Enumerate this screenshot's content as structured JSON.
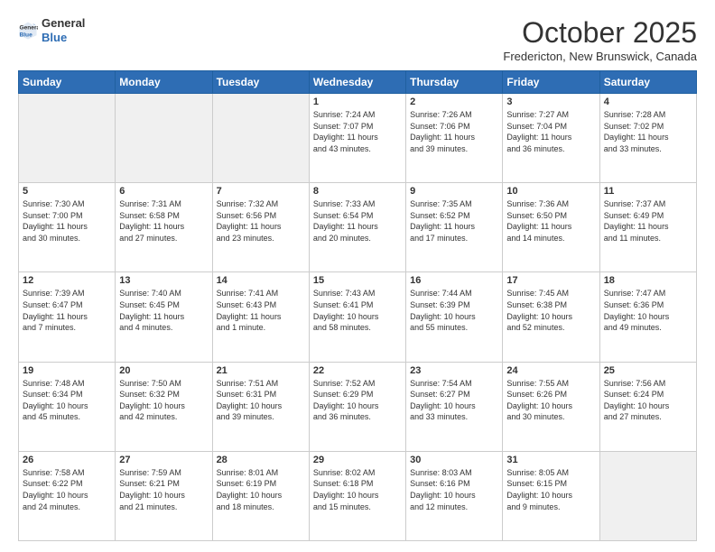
{
  "header": {
    "logo_general": "General",
    "logo_blue": "Blue",
    "month": "October 2025",
    "location": "Fredericton, New Brunswick, Canada"
  },
  "days_of_week": [
    "Sunday",
    "Monday",
    "Tuesday",
    "Wednesday",
    "Thursday",
    "Friday",
    "Saturday"
  ],
  "weeks": [
    [
      {
        "day": "",
        "info": "",
        "gray": true
      },
      {
        "day": "",
        "info": "",
        "gray": true
      },
      {
        "day": "",
        "info": "",
        "gray": true
      },
      {
        "day": "1",
        "info": "Sunrise: 7:24 AM\nSunset: 7:07 PM\nDaylight: 11 hours\nand 43 minutes."
      },
      {
        "day": "2",
        "info": "Sunrise: 7:26 AM\nSunset: 7:06 PM\nDaylight: 11 hours\nand 39 minutes."
      },
      {
        "day": "3",
        "info": "Sunrise: 7:27 AM\nSunset: 7:04 PM\nDaylight: 11 hours\nand 36 minutes."
      },
      {
        "day": "4",
        "info": "Sunrise: 7:28 AM\nSunset: 7:02 PM\nDaylight: 11 hours\nand 33 minutes."
      }
    ],
    [
      {
        "day": "5",
        "info": "Sunrise: 7:30 AM\nSunset: 7:00 PM\nDaylight: 11 hours\nand 30 minutes."
      },
      {
        "day": "6",
        "info": "Sunrise: 7:31 AM\nSunset: 6:58 PM\nDaylight: 11 hours\nand 27 minutes."
      },
      {
        "day": "7",
        "info": "Sunrise: 7:32 AM\nSunset: 6:56 PM\nDaylight: 11 hours\nand 23 minutes."
      },
      {
        "day": "8",
        "info": "Sunrise: 7:33 AM\nSunset: 6:54 PM\nDaylight: 11 hours\nand 20 minutes."
      },
      {
        "day": "9",
        "info": "Sunrise: 7:35 AM\nSunset: 6:52 PM\nDaylight: 11 hours\nand 17 minutes."
      },
      {
        "day": "10",
        "info": "Sunrise: 7:36 AM\nSunset: 6:50 PM\nDaylight: 11 hours\nand 14 minutes."
      },
      {
        "day": "11",
        "info": "Sunrise: 7:37 AM\nSunset: 6:49 PM\nDaylight: 11 hours\nand 11 minutes."
      }
    ],
    [
      {
        "day": "12",
        "info": "Sunrise: 7:39 AM\nSunset: 6:47 PM\nDaylight: 11 hours\nand 7 minutes."
      },
      {
        "day": "13",
        "info": "Sunrise: 7:40 AM\nSunset: 6:45 PM\nDaylight: 11 hours\nand 4 minutes."
      },
      {
        "day": "14",
        "info": "Sunrise: 7:41 AM\nSunset: 6:43 PM\nDaylight: 11 hours\nand 1 minute."
      },
      {
        "day": "15",
        "info": "Sunrise: 7:43 AM\nSunset: 6:41 PM\nDaylight: 10 hours\nand 58 minutes."
      },
      {
        "day": "16",
        "info": "Sunrise: 7:44 AM\nSunset: 6:39 PM\nDaylight: 10 hours\nand 55 minutes."
      },
      {
        "day": "17",
        "info": "Sunrise: 7:45 AM\nSunset: 6:38 PM\nDaylight: 10 hours\nand 52 minutes."
      },
      {
        "day": "18",
        "info": "Sunrise: 7:47 AM\nSunset: 6:36 PM\nDaylight: 10 hours\nand 49 minutes."
      }
    ],
    [
      {
        "day": "19",
        "info": "Sunrise: 7:48 AM\nSunset: 6:34 PM\nDaylight: 10 hours\nand 45 minutes."
      },
      {
        "day": "20",
        "info": "Sunrise: 7:50 AM\nSunset: 6:32 PM\nDaylight: 10 hours\nand 42 minutes."
      },
      {
        "day": "21",
        "info": "Sunrise: 7:51 AM\nSunset: 6:31 PM\nDaylight: 10 hours\nand 39 minutes."
      },
      {
        "day": "22",
        "info": "Sunrise: 7:52 AM\nSunset: 6:29 PM\nDaylight: 10 hours\nand 36 minutes."
      },
      {
        "day": "23",
        "info": "Sunrise: 7:54 AM\nSunset: 6:27 PM\nDaylight: 10 hours\nand 33 minutes."
      },
      {
        "day": "24",
        "info": "Sunrise: 7:55 AM\nSunset: 6:26 PM\nDaylight: 10 hours\nand 30 minutes."
      },
      {
        "day": "25",
        "info": "Sunrise: 7:56 AM\nSunset: 6:24 PM\nDaylight: 10 hours\nand 27 minutes."
      }
    ],
    [
      {
        "day": "26",
        "info": "Sunrise: 7:58 AM\nSunset: 6:22 PM\nDaylight: 10 hours\nand 24 minutes."
      },
      {
        "day": "27",
        "info": "Sunrise: 7:59 AM\nSunset: 6:21 PM\nDaylight: 10 hours\nand 21 minutes."
      },
      {
        "day": "28",
        "info": "Sunrise: 8:01 AM\nSunset: 6:19 PM\nDaylight: 10 hours\nand 18 minutes."
      },
      {
        "day": "29",
        "info": "Sunrise: 8:02 AM\nSunset: 6:18 PM\nDaylight: 10 hours\nand 15 minutes."
      },
      {
        "day": "30",
        "info": "Sunrise: 8:03 AM\nSunset: 6:16 PM\nDaylight: 10 hours\nand 12 minutes."
      },
      {
        "day": "31",
        "info": "Sunrise: 8:05 AM\nSunset: 6:15 PM\nDaylight: 10 hours\nand 9 minutes."
      },
      {
        "day": "",
        "info": "",
        "gray": true
      }
    ]
  ]
}
